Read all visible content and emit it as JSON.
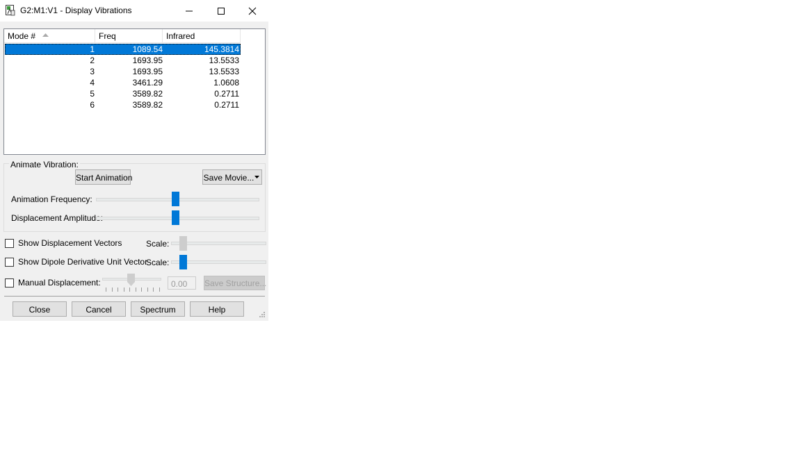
{
  "window": {
    "title": "G2:M1:V1 - Display Vibrations",
    "icons": {
      "app": "gaussview-icon",
      "minimize": "minimize-icon",
      "maximize": "maximize-icon",
      "close": "close-icon"
    }
  },
  "table": {
    "columns": [
      "Mode #",
      "Freq",
      "Infrared"
    ],
    "sort_icon": "sort-ascending-icon",
    "rows": [
      {
        "mode": "1",
        "freq": "1089.54",
        "ir": "145.3814"
      },
      {
        "mode": "2",
        "freq": "1693.95",
        "ir": "13.5533"
      },
      {
        "mode": "3",
        "freq": "1693.95",
        "ir": "13.5533"
      },
      {
        "mode": "4",
        "freq": "3461.29",
        "ir": "1.0608"
      },
      {
        "mode": "5",
        "freq": "3589.82",
        "ir": "0.2711"
      },
      {
        "mode": "6",
        "freq": "3589.82",
        "ir": "0.2711"
      }
    ],
    "selected_row": 0
  },
  "animate": {
    "group_label": "Animate Vibration:",
    "start_label": "Start Animation",
    "save_movie_label": "Save Movie...",
    "freq_label": "Animation Frequency:",
    "freq_level": 0.49,
    "amp_label": "Displacement Amplitude:",
    "amp_level": 0.49
  },
  "options": {
    "vectors_label": "Show Displacement Vectors",
    "vectors_checked": false,
    "scale1_label": "Scale:",
    "scale1_level": 0.1,
    "dipole_label": "Show Dipole Derivative Unit Vector",
    "dipole_checked": false,
    "scale2_label": "Scale:",
    "scale2_level": 0.1,
    "manual_label": "Manual Displacement:",
    "manual_checked": false,
    "manual_level": 0.5,
    "manual_value": "0.00",
    "save_structure_label": "Save Structure..."
  },
  "footer": {
    "close_label": "Close",
    "cancel_label": "Cancel",
    "spectrum_label": "Spectrum",
    "help_label": "Help"
  },
  "colors": {
    "selection": "#0078d7",
    "dialog_bg": "#f0f0f0",
    "button_bg": "#e1e1e1"
  }
}
